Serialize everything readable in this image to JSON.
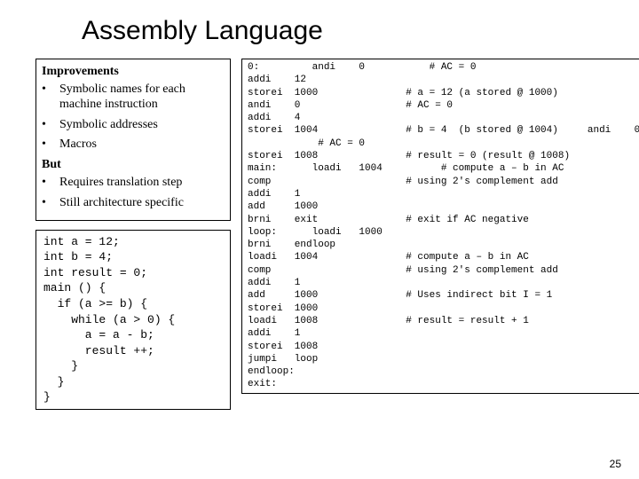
{
  "title": "Assembly Language",
  "left": {
    "improvements_head": "Improvements",
    "improvements": [
      "Symbolic names for each machine instruction",
      "Symbolic addresses",
      "Macros"
    ],
    "but_head": "But",
    "but": [
      "Requires translation step",
      "Still architecture specific"
    ]
  },
  "c_code": "int a = 12;\nint b = 4;\nint result = 0;\nmain () {\n  if (a >= b) {\n    while (a > 0) {\n      a = a - b;\n      result ++;\n    }\n  }\n}",
  "asm_code": "0:         andi    0           # AC = 0\naddi    12\nstorei  1000               # a = 12 (a stored @ 1000)\nandi    0                  # AC = 0\naddi    4\nstorei  1004               # b = 4  (b stored @ 1004)     andi    0\n            # AC = 0\nstorei  1008               # result = 0 (result @ 1008)\nmain:      loadi   1004          # compute a – b in AC\ncomp                       # using 2's complement add\naddi    1\nadd     1000\nbrni    exit               # exit if AC negative\nloop:      loadi   1000\nbrni    endloop\nloadi   1004               # compute a – b in AC\ncomp                       # using 2's complement add\naddi    1\nadd     1000               # Uses indirect bit I = 1\nstorei  1000\nloadi   1008               # result = result + 1\naddi    1\nstorei  1008\njumpi   loop\nendloop:\nexit:",
  "page_number": "25"
}
